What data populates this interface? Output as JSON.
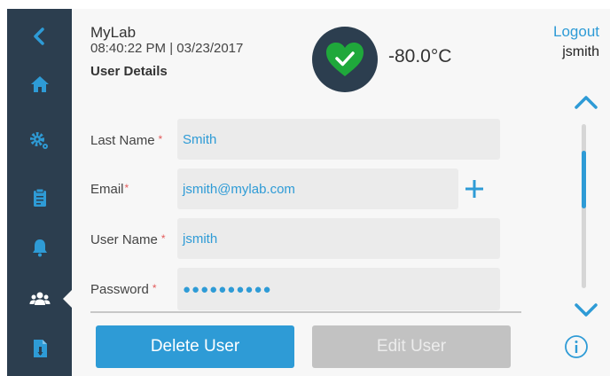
{
  "header": {
    "app_name": "MyLab",
    "datetime": "08:40:22 PM | 03/23/2017",
    "page_title": "User Details",
    "temperature": "-80.0°C",
    "logout_label": "Logout",
    "username": "jsmith"
  },
  "status": {
    "icon": "heart-check-icon",
    "state": "ok",
    "color": "#1fa83b"
  },
  "sidebar": {
    "items": [
      {
        "icon": "back-chevron-icon",
        "active": false
      },
      {
        "icon": "home-icon",
        "active": false
      },
      {
        "icon": "gears-icon",
        "active": false
      },
      {
        "icon": "clipboard-icon",
        "active": false
      },
      {
        "icon": "bell-icon",
        "active": false
      },
      {
        "icon": "users-icon",
        "active": true
      },
      {
        "icon": "file-info-icon",
        "active": false
      }
    ]
  },
  "form": {
    "last_name": {
      "label": "Last Name",
      "required_marker": "*",
      "value": "Smith"
    },
    "email": {
      "label": "Email",
      "required_marker": "*",
      "value": "jsmith@mylab.com"
    },
    "user_name": {
      "label": "User Name",
      "required_marker": "*",
      "value": "jsmith"
    },
    "password": {
      "label": "Password",
      "required_marker": "*",
      "value": "●●●●●●●●●●"
    }
  },
  "buttons": {
    "delete_label": "Delete User",
    "edit_label": "Edit User"
  },
  "colors": {
    "accent": "#2e9bd6",
    "sidebar": "#2c3e4f",
    "required": "#e35a5a",
    "disabled": "#c2c2c2"
  }
}
